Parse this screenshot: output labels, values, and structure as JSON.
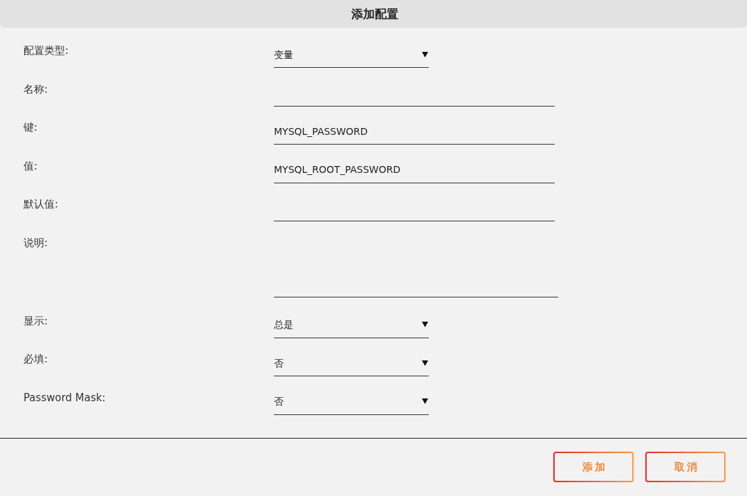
{
  "dialog": {
    "title": "添加配置"
  },
  "fields": [
    {
      "label": "配置类型:",
      "kind": "select",
      "value": "变量"
    },
    {
      "label": "名称:",
      "kind": "input"
    },
    {
      "label": "键:",
      "kind": "input",
      "value": "MYSQL_PASSWORD"
    },
    {
      "label": "值:",
      "kind": "input",
      "value": "MYSQL_ROOT_PASSWORD"
    },
    {
      "label": "默认值:",
      "kind": "input"
    },
    {
      "label": "说明:",
      "kind": "textarea"
    },
    {
      "label": "显示:",
      "kind": "select",
      "value": "总是"
    },
    {
      "label": "必填:",
      "kind": "select",
      "value": "否"
    },
    {
      "label": "Password Mask:",
      "kind": "select",
      "value": "否"
    }
  ],
  "buttons": [
    {
      "label": "添加"
    },
    {
      "label": "取消"
    }
  ]
}
